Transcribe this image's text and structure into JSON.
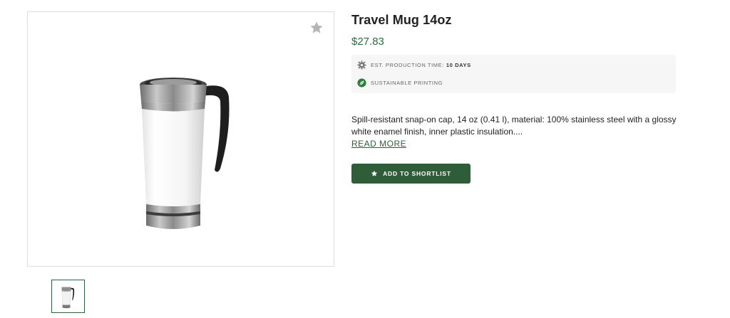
{
  "product": {
    "title": "Travel Mug 14oz",
    "price": "$27.83",
    "image_icon": "travel-mug-image",
    "favorite_icon": "star-icon"
  },
  "info": {
    "production_label": "EST. PRODUCTION TIME:",
    "production_value": "10 DAYS",
    "production_icon": "gear-icon",
    "sustainable_label": "SUSTAINABLE PRINTING",
    "sustainable_icon": "leaf-icon"
  },
  "description": {
    "text": "Spill-resistant snap-on cap, 14 oz (0.41 l), material: 100% stainless steel with a glossy white enamel finish, inner plastic insulation....",
    "read_more": "READ MORE"
  },
  "actions": {
    "shortlist_label": "ADD TO SHORTLIST",
    "shortlist_icon": "star-icon"
  },
  "colors": {
    "accent_green": "#2f5d3a",
    "price_green": "#2e6b3f"
  }
}
